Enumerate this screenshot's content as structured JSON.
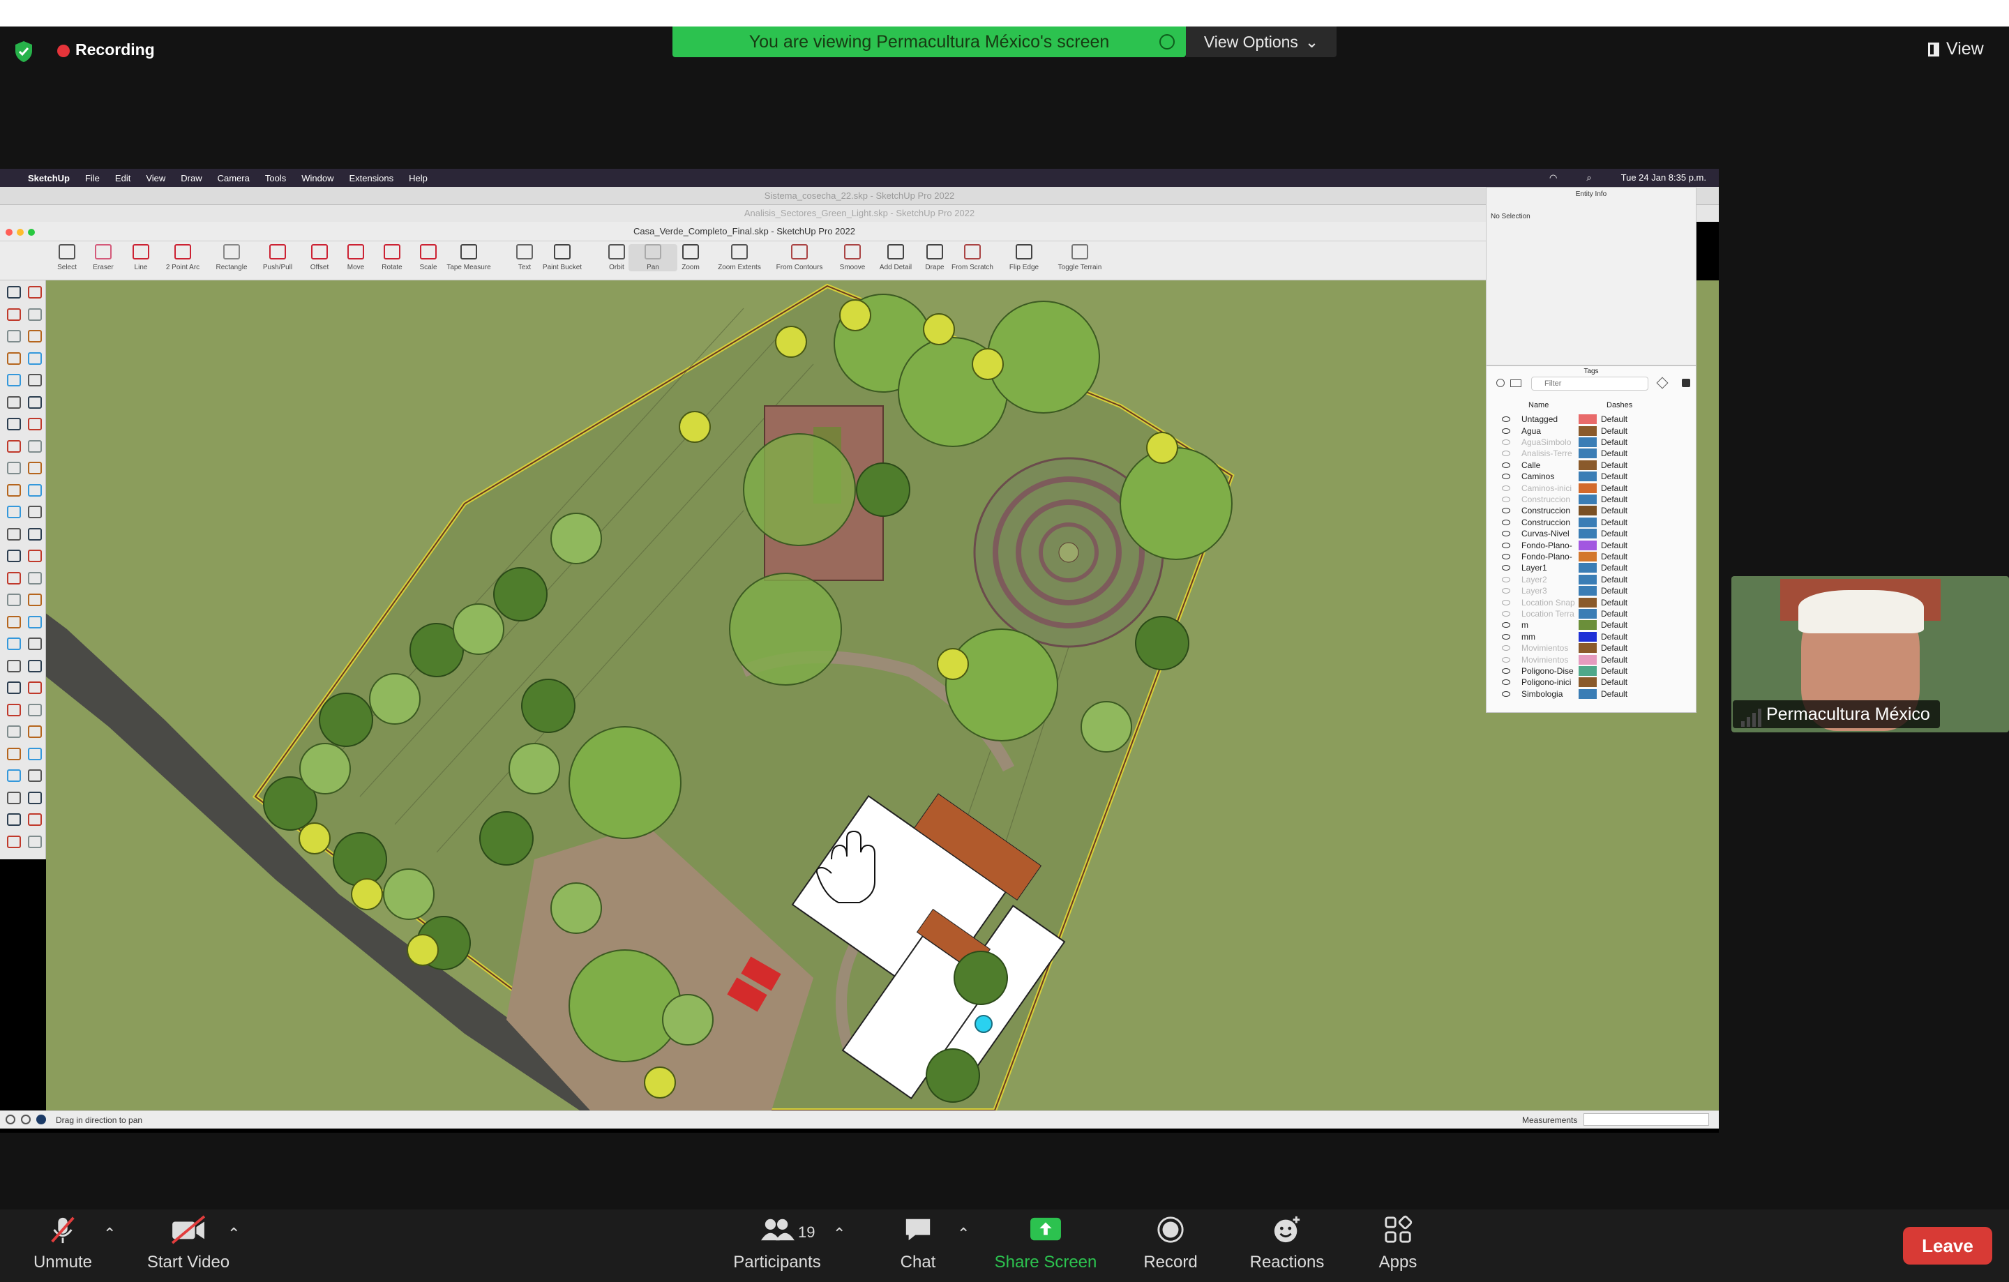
{
  "zoom": {
    "recording_label": "Recording",
    "banner_text": "You are viewing Permacultura México's screen",
    "view_options_label": "View Options",
    "view_label": "View",
    "participant_name": "Permacultura México",
    "participants_count": "19",
    "bottom": {
      "unmute": "Unmute",
      "start_video": "Start Video",
      "participants": "Participants",
      "chat": "Chat",
      "share_screen": "Share Screen",
      "record": "Record",
      "reactions": "Reactions",
      "apps": "Apps",
      "leave": "Leave"
    },
    "colors": {
      "banner": "#2cc24f",
      "leave": "#d83a35",
      "share": "#2cc24f",
      "rec": "#e5343a"
    }
  },
  "mac_menu": {
    "app": "SketchUp",
    "items": [
      "File",
      "Edit",
      "View",
      "Draw",
      "Camera",
      "Tools",
      "Window",
      "Extensions",
      "Help"
    ],
    "clock": "Tue 24 Jan  8:35 p.m."
  },
  "windows": {
    "back1": "Sistema_cosecha_22.skp - SketchUp Pro 2022",
    "back2": "Analisis_Sectores_Green_Light.skp - SketchUp Pro 2022",
    "front": "Casa_Verde_Completo_Final.skp - SketchUp Pro 2022"
  },
  "toolbar": [
    {
      "label": "Select",
      "icon": "select-arrow-icon"
    },
    {
      "label": "Eraser",
      "icon": "eraser-icon"
    },
    {
      "label": "Line",
      "icon": "pencil-line-icon"
    },
    {
      "label": "2 Point Arc",
      "icon": "arc-icon"
    },
    {
      "label": "Rectangle",
      "icon": "rectangle-icon"
    },
    {
      "label": "Push/Pull",
      "icon": "push-pull-icon"
    },
    {
      "label": "Offset",
      "icon": "offset-icon"
    },
    {
      "label": "Move",
      "icon": "move-icon"
    },
    {
      "label": "Rotate",
      "icon": "rotate-icon"
    },
    {
      "label": "Scale",
      "icon": "scale-icon"
    },
    {
      "label": "Tape Measure",
      "icon": "tape-measure-icon"
    },
    {
      "label": "Text",
      "icon": "text-icon"
    },
    {
      "label": "Paint Bucket",
      "icon": "paint-bucket-icon"
    },
    {
      "label": "Orbit",
      "icon": "orbit-icon"
    },
    {
      "label": "Pan",
      "icon": "pan-hand-icon"
    },
    {
      "label": "Zoom",
      "icon": "zoom-icon"
    },
    {
      "label": "Zoom Extents",
      "icon": "zoom-extents-icon"
    },
    {
      "label": "From Contours",
      "icon": "from-contours-icon"
    },
    {
      "label": "Smoove",
      "icon": "smoove-icon"
    },
    {
      "label": "Add Detail",
      "icon": "add-detail-icon"
    },
    {
      "label": "Drape",
      "icon": "drape-icon"
    },
    {
      "label": "From Scratch",
      "icon": "from-scratch-icon"
    },
    {
      "label": "Flip Edge",
      "icon": "flip-edge-icon"
    },
    {
      "label": "Toggle Terrain",
      "icon": "toggle-terrain-icon"
    }
  ],
  "entity_info": {
    "title": "Entity Info",
    "selection": "No Selection"
  },
  "tags_panel": {
    "title": "Tags",
    "filter_placeholder": "Filter",
    "col_name": "Name",
    "col_dashes": "Dashes",
    "rows": [
      {
        "name": "Untagged",
        "dashes": "Default",
        "color": "#e86a6a",
        "visible": true
      },
      {
        "name": "Agua",
        "dashes": "Default",
        "color": "#8a5a2b",
        "visible": true
      },
      {
        "name": "AguaSimbolo",
        "dashes": "Default",
        "color": "#3a7db5",
        "visible": false
      },
      {
        "name": "Analisis-Terre",
        "dashes": "Default",
        "color": "#3a7db5",
        "visible": false
      },
      {
        "name": "Calle",
        "dashes": "Default",
        "color": "#8a5a2b",
        "visible": true
      },
      {
        "name": "Caminos",
        "dashes": "Default",
        "color": "#3a7db5",
        "visible": true
      },
      {
        "name": "Caminos-inici",
        "dashes": "Default",
        "color": "#d36a2c",
        "visible": false
      },
      {
        "name": "Construccion",
        "dashes": "Default",
        "color": "#3a7db5",
        "visible": false
      },
      {
        "name": "Construccion",
        "dashes": "Default",
        "color": "#7a5024",
        "visible": true
      },
      {
        "name": "Construccion",
        "dashes": "Default",
        "color": "#3a7db5",
        "visible": true
      },
      {
        "name": "Curvas-Nivel",
        "dashes": "Default",
        "color": "#3a7db5",
        "visible": true
      },
      {
        "name": "Fondo-Plano-",
        "dashes": "Default",
        "color": "#a257e0",
        "visible": true
      },
      {
        "name": "Fondo-Plano-",
        "dashes": "Default",
        "color": "#d3772c",
        "visible": true
      },
      {
        "name": "Layer1",
        "dashes": "Default",
        "color": "#3a7db5",
        "visible": true
      },
      {
        "name": "Layer2",
        "dashes": "Default",
        "color": "#3a7db5",
        "visible": false
      },
      {
        "name": "Layer3",
        "dashes": "Default",
        "color": "#3a7db5",
        "visible": false
      },
      {
        "name": "Location Snap",
        "dashes": "Default",
        "color": "#8a5a2b",
        "visible": false
      },
      {
        "name": "Location Terra",
        "dashes": "Default",
        "color": "#3a7db5",
        "visible": false
      },
      {
        "name": "m",
        "dashes": "Default",
        "color": "#6b8f3a",
        "visible": true
      },
      {
        "name": "mm",
        "dashes": "Default",
        "color": "#1e2fd6",
        "visible": true
      },
      {
        "name": "Movimientos",
        "dashes": "Default",
        "color": "#8a5a2b",
        "visible": false
      },
      {
        "name": "Movimientos",
        "dashes": "Default",
        "color": "#e59bbf",
        "visible": false
      },
      {
        "name": "Poligono-Dise",
        "dashes": "Default",
        "color": "#4fa88a",
        "visible": true
      },
      {
        "name": "Poligono-inici",
        "dashes": "Default",
        "color": "#8a5a2b",
        "visible": true
      },
      {
        "name": "Simbologia",
        "dashes": "Default",
        "color": "#3a7db5",
        "visible": true
      }
    ]
  },
  "status": {
    "hint": "Drag in direction to pan",
    "measurements": "Measurements"
  }
}
